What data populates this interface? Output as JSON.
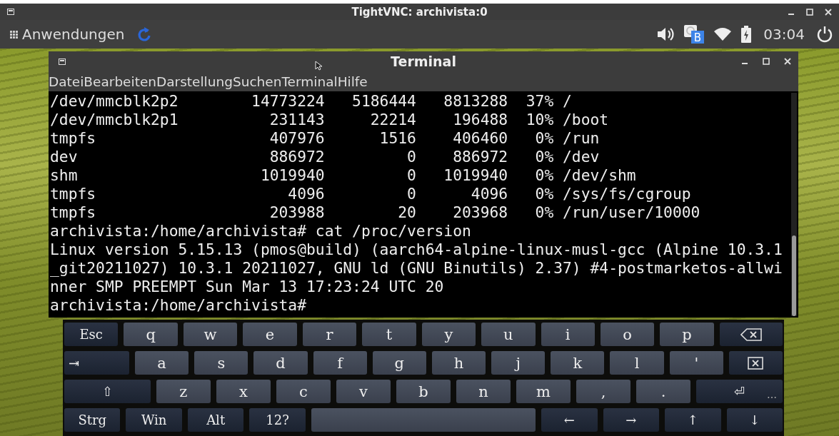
{
  "vnc_window": {
    "title": "TightVNC: archivista:0"
  },
  "panel": {
    "menu_label": "Anwendungen",
    "layout_badge": "B",
    "clock": "03:04"
  },
  "terminal": {
    "title": "Terminal",
    "menu": [
      "Datei",
      "Bearbeiten",
      "Darstellung",
      "Suchen",
      "Terminal",
      "Hilfe"
    ],
    "lines": [
      "/dev/mmcblk2p2        14773224   5186444   8813288  37% /",
      "/dev/mmcblk2p1          231143     22214    196488  10% /boot",
      "tmpfs                   407976      1516    406460   0% /run",
      "dev                     886972         0    886972   0% /dev",
      "shm                    1019940         0   1019940   0% /dev/shm",
      "tmpfs                     4096         0      4096   0% /sys/fs/cgroup",
      "tmpfs                   203988        20    203968   0% /run/user/10000",
      "archivista:/home/archivista# cat /proc/version",
      "Linux version 5.15.13 (pmos@build) (aarch64-alpine-linux-musl-gcc (Alpine 10.3.1",
      "_git20211027) 10.3.1 20211027, GNU ld (GNU Binutils) 2.37) #4-postmarketos-allwi",
      "nner SMP PREEMPT Sun Mar 13 17:23:24 UTC 20",
      "archivista:/home/archivista#"
    ]
  },
  "keyboard": {
    "rows": [
      [
        {
          "label": "Esc",
          "kind": "mod"
        },
        {
          "label": "q",
          "kind": "char"
        },
        {
          "label": "w",
          "kind": "char"
        },
        {
          "label": "e",
          "kind": "char"
        },
        {
          "label": "r",
          "kind": "char"
        },
        {
          "label": "t",
          "kind": "char"
        },
        {
          "label": "y",
          "kind": "char"
        },
        {
          "label": "u",
          "kind": "char"
        },
        {
          "label": "i",
          "kind": "char"
        },
        {
          "label": "o",
          "kind": "char"
        },
        {
          "label": "p",
          "kind": "char"
        },
        {
          "kind": "backspace"
        }
      ],
      [
        {
          "label": "⇥",
          "kind": "wide"
        },
        {
          "label": "a",
          "kind": "char"
        },
        {
          "label": "s",
          "kind": "char"
        },
        {
          "label": "d",
          "kind": "char"
        },
        {
          "label": "f",
          "kind": "char"
        },
        {
          "label": "g",
          "kind": "char"
        },
        {
          "label": "h",
          "kind": "char"
        },
        {
          "label": "j",
          "kind": "char"
        },
        {
          "label": "k",
          "kind": "char"
        },
        {
          "label": "l",
          "kind": "char"
        },
        {
          "label": "'",
          "kind": "char"
        },
        {
          "kind": "delete"
        }
      ],
      [
        {
          "label": "⇧",
          "kind": "xwide"
        },
        {
          "label": "z",
          "kind": "char"
        },
        {
          "label": "x",
          "kind": "char"
        },
        {
          "label": "c",
          "kind": "char"
        },
        {
          "label": "v",
          "kind": "char"
        },
        {
          "label": "b",
          "kind": "char"
        },
        {
          "label": "n",
          "kind": "char"
        },
        {
          "label": "m",
          "kind": "char"
        },
        {
          "label": ",",
          "kind": "char"
        },
        {
          "label": ".",
          "kind": "char"
        },
        {
          "label": "⏎",
          "hint": "…",
          "kind": "xwide"
        }
      ],
      [
        {
          "label": "Strg",
          "kind": "mod"
        },
        {
          "label": "Win",
          "kind": "mod"
        },
        {
          "label": "Alt",
          "kind": "mod"
        },
        {
          "label": "12?",
          "kind": "mod"
        },
        {
          "kind": "space"
        },
        {
          "label": "←",
          "kind": "mod"
        },
        {
          "label": "→",
          "kind": "mod"
        },
        {
          "label": "↑",
          "kind": "mod"
        },
        {
          "label": "↓",
          "kind": "mod"
        }
      ]
    ]
  }
}
